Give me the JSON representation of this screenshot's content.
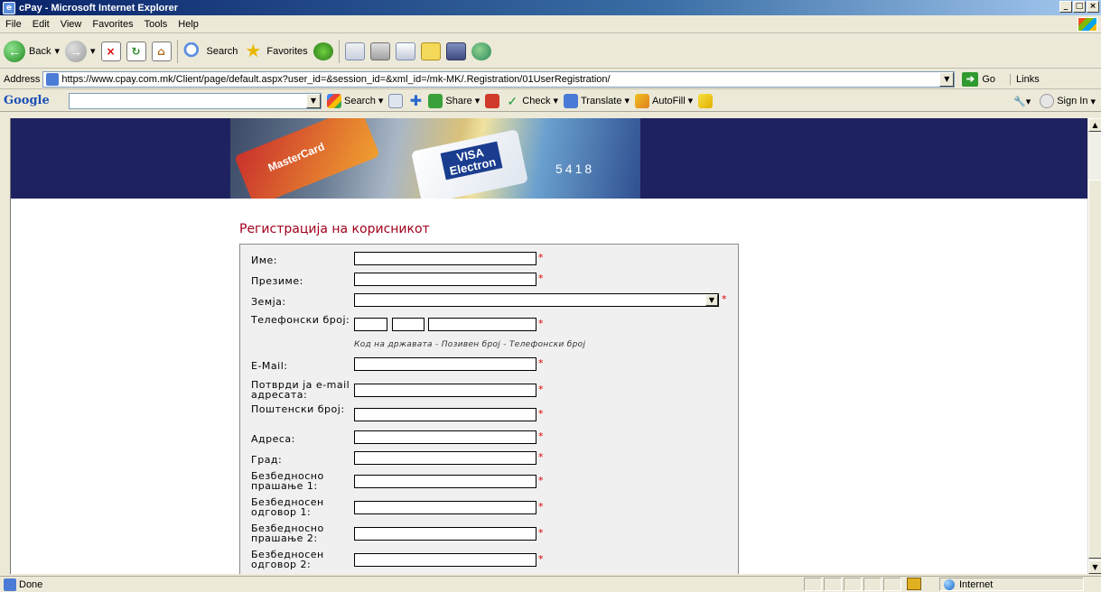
{
  "window": {
    "title": "cPay - Microsoft Internet Explorer",
    "buttons": {
      "minimize": "_",
      "maximize": "□",
      "close": "×"
    }
  },
  "menu": [
    "File",
    "Edit",
    "View",
    "Favorites",
    "Tools",
    "Help"
  ],
  "toolbar": {
    "back": "Back",
    "search": "Search",
    "favorites": "Favorites"
  },
  "address": {
    "label": "Address",
    "url": "https://www.cpay.com.mk/Client/page/default.aspx?user_id=&session_id=&xml_id=/mk-MK/.Registration/01UserRegistration/",
    "go": "Go",
    "links": "Links"
  },
  "google": {
    "logo": "Google",
    "search": "Search",
    "share": "Share",
    "check": "Check",
    "translate": "Translate",
    "autofill": "AutoFill",
    "sign_in": "Sign In"
  },
  "banner": {
    "mastercard": "MasterCard",
    "visa": "VISA",
    "electron": "Electron",
    "card_number": "5418"
  },
  "form": {
    "title": "Регистрација на корисникот",
    "required_mark": "*",
    "phone_hint": "Код на државата - Позивен број - Телефонски број",
    "fields": {
      "first_name": "Име:",
      "last_name": "Презиме:",
      "country": "Земја:",
      "phone": "Телефонски број:",
      "email": "E-Mail:",
      "email_confirm": "Потврди ја e-mail адресата:",
      "postal_code": "Поштенски број:",
      "address": "Адреса:",
      "city": "Град:",
      "security_q1": "Безбедносно прашање 1:",
      "security_a1": "Безбедносен одговор 1:",
      "security_q2": "Безбедносно прашање 2:",
      "security_a2": "Безбедносен одговор 2:"
    }
  },
  "status": {
    "text": "Done",
    "zone": "Internet"
  }
}
